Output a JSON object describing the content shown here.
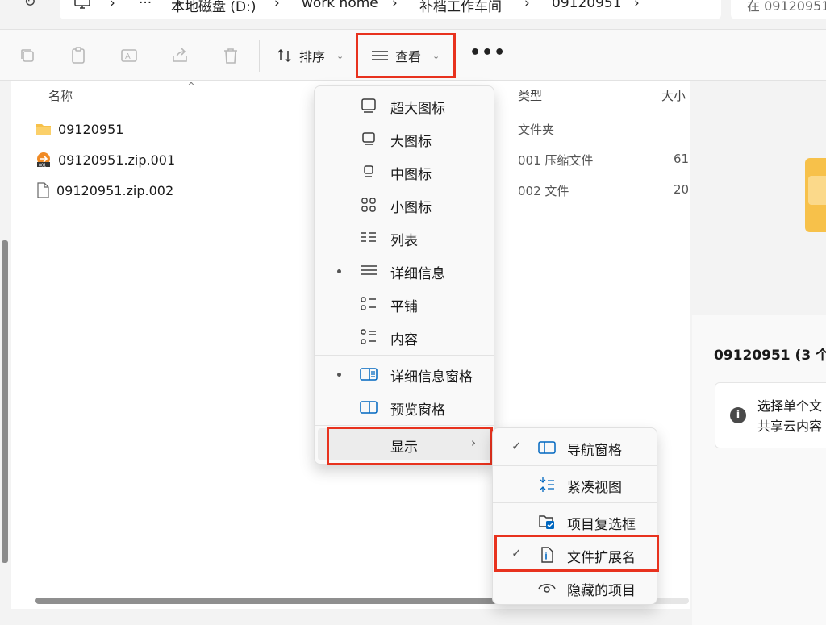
{
  "address": {
    "refresh_glyph": "↻",
    "segments": [
      "›",
      "···",
      "›",
      "本地磁盘 (D:)",
      "›",
      "work home",
      "›",
      "补档工作车间",
      "›",
      "09120951",
      "›"
    ],
    "search_placeholder": "在 09120951"
  },
  "toolbar": {
    "sort_label": "排序",
    "view_label": "查看",
    "more_label": "•••"
  },
  "filelist": {
    "col_name": "名称",
    "col_type": "类型",
    "col_size": "大小",
    "sort_caret": "^",
    "rows": [
      {
        "name": "09120951",
        "type": "文件夹",
        "size": "",
        "icon": "folder-icon"
      },
      {
        "name": "09120951.zip.001",
        "type": "001 压缩文件",
        "size": "61",
        "icon": "archive-001-icon"
      },
      {
        "name": "09120951.zip.002",
        "type": "002 文件",
        "size": "20",
        "icon": "file-icon"
      }
    ]
  },
  "details": {
    "title": "09120951 (3 个",
    "info_line1": "选择单个文",
    "info_line2": "共享云内容"
  },
  "view_menu": {
    "items": [
      {
        "label": "超大图标",
        "icon": "extra-large-icons-icon",
        "selected": false
      },
      {
        "label": "大图标",
        "icon": "large-icons-icon",
        "selected": false
      },
      {
        "label": "中图标",
        "icon": "medium-icons-icon",
        "selected": false
      },
      {
        "label": "小图标",
        "icon": "small-icons-icon",
        "selected": false
      },
      {
        "label": "列表",
        "icon": "list-icon",
        "selected": false
      },
      {
        "label": "详细信息",
        "icon": "details-icon",
        "selected": true
      },
      {
        "label": "平铺",
        "icon": "tiles-icon",
        "selected": false
      },
      {
        "label": "内容",
        "icon": "content-icon",
        "selected": false
      },
      {
        "label": "详细信息窗格",
        "icon": "details-pane-icon",
        "selected": true
      },
      {
        "label": "预览窗格",
        "icon": "preview-pane-icon",
        "selected": false
      }
    ],
    "show_label": "显示",
    "show_arrow": "›"
  },
  "show_submenu": {
    "items": [
      {
        "label": "导航窗格",
        "icon": "navigation-pane-icon",
        "checked": true
      },
      {
        "label": "紧凑视图",
        "icon": "compact-view-icon",
        "checked": false
      },
      {
        "label": "项目复选框",
        "icon": "item-checkboxes-icon",
        "checked": false
      },
      {
        "label": "文件扩展名",
        "icon": "file-extensions-icon",
        "checked": true
      },
      {
        "label": "隐藏的项目",
        "icon": "hidden-items-icon",
        "checked": false
      }
    ],
    "check_glyph": "✓"
  },
  "colors": {
    "highlight_box": "#e8321e",
    "folder": "#f7c14a",
    "accent": "#0067c0"
  }
}
